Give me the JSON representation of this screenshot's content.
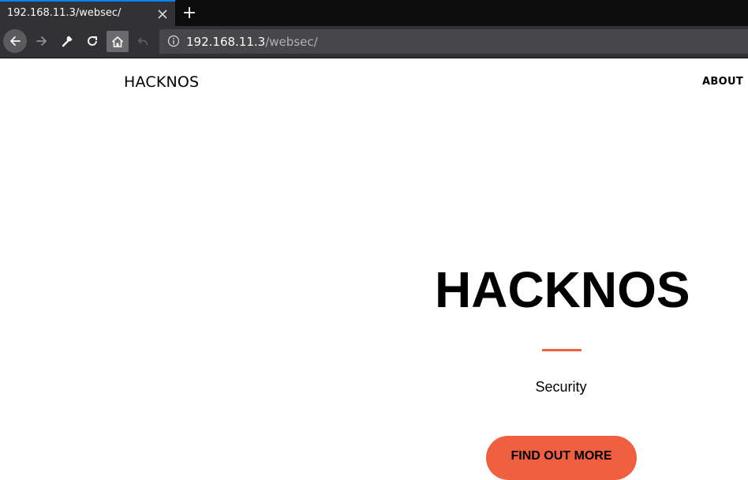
{
  "browser": {
    "tab_title": "192.168.11.3/websec/",
    "url_host": "192.168.11.3",
    "url_path": "/websec/",
    "accent_color": "#0a84ff",
    "icons": [
      "back-icon",
      "forward-icon",
      "wrench-icon",
      "reload-icon",
      "home-icon",
      "undo-icon",
      "info-icon",
      "close-icon",
      "plus-icon"
    ]
  },
  "site": {
    "brand": "HACKNOS",
    "nav": {
      "about_label": "ABOUT"
    },
    "hero": {
      "title": "HACKNOS",
      "subtitle": "Security",
      "button_label": "FIND OUT MORE",
      "accent_color": "#f05f40"
    }
  }
}
